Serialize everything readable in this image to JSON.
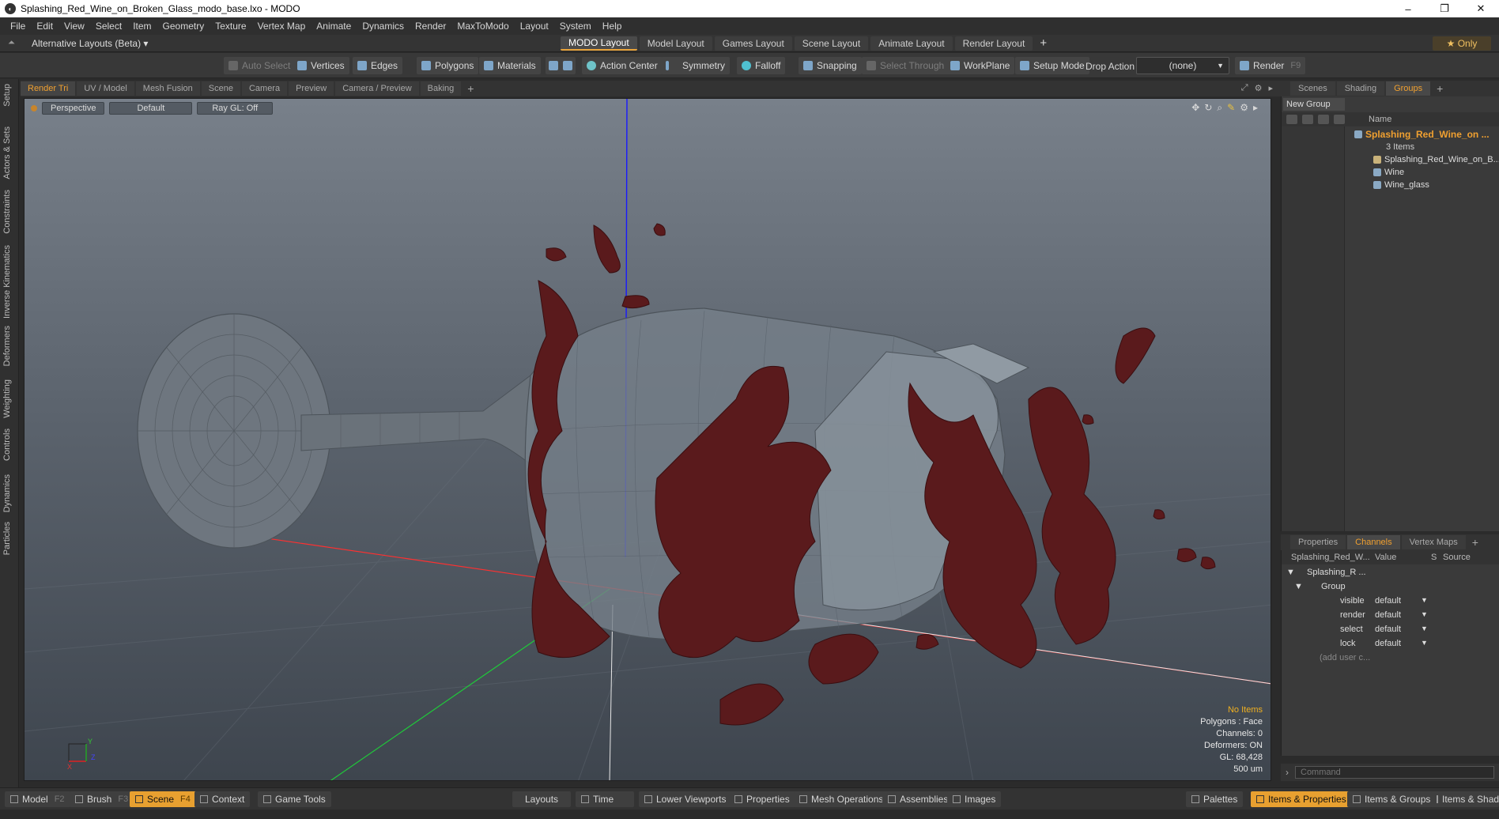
{
  "window": {
    "title": "Splashing_Red_Wine_on_Broken_Glass_modo_base.lxo - MODO",
    "minimize": "–",
    "restore": "❐",
    "close": "✕"
  },
  "menu": [
    "File",
    "Edit",
    "View",
    "Select",
    "Item",
    "Geometry",
    "Texture",
    "Vertex Map",
    "Animate",
    "Dynamics",
    "Render",
    "MaxToModo",
    "Layout",
    "System",
    "Help"
  ],
  "layoutbar": {
    "alt_layouts": "Alternative Layouts (Beta) ▾",
    "tabs": [
      "MODO Layout",
      "Model Layout",
      "Games Layout",
      "Scene Layout",
      "Animate Layout",
      "Render Layout"
    ],
    "add": "+",
    "only": "★  Only"
  },
  "toolbar": {
    "auto_select": "Auto Select",
    "vertices": "Vertices",
    "edges": "Edges",
    "polygons": "Polygons",
    "materials": "Materials",
    "action_center": "Action Center",
    "symmetry": "Symmetry",
    "falloff": "Falloff",
    "snapping": "Snapping",
    "select_through": "Select Through",
    "workplane": "WorkPlane",
    "setup_mode": "Setup Mode",
    "drop_action": "Drop Action",
    "drop_value": "(none)",
    "render": "Render",
    "render_key": "F9"
  },
  "left_tabs": [
    "Setup",
    "Actors & Sets",
    "Constraints",
    "Inverse Kinematics",
    "Deformers",
    "Weighting",
    "Controls",
    "Dynamics",
    "Particles"
  ],
  "viewport_tabs": [
    "Render Tri",
    "UV / Model",
    "Mesh Fusion",
    "Scene",
    "Camera",
    "Preview",
    "Camera / Preview",
    "Baking"
  ],
  "viewport": {
    "perspective": "Perspective",
    "default": "Default",
    "raygl": "Ray GL: Off",
    "info": {
      "no_items": "No Items",
      "polygons": "Polygons : Face",
      "channels": "Channels: 0",
      "deformers": "Deformers: ON",
      "gl": "GL: 68,428",
      "scale": "500 um"
    }
  },
  "right_tabs": [
    "Scenes",
    "Shading",
    "Groups"
  ],
  "groups": {
    "new_group": "New Group",
    "name_col": "Name",
    "group_name": "Splashing_Red_Wine_on ...",
    "count": "3 Items",
    "items": [
      "Splashing_Red_Wine_on_B...",
      "Wine",
      "Wine_glass"
    ]
  },
  "channel_tabs": [
    "Properties",
    "Channels",
    "Vertex Maps"
  ],
  "channels": {
    "head_name": "Splashing_Red_W...",
    "head_value": "Value",
    "head_s": "S",
    "head_source": "Source",
    "item": "Splashing_R ...",
    "group": "Group",
    "rows": [
      {
        "name": "visible",
        "value": "default"
      },
      {
        "name": "render",
        "value": "default"
      },
      {
        "name": "select",
        "value": "default"
      },
      {
        "name": "lock",
        "value": "default"
      }
    ],
    "add_user": "(add user c...",
    "command_placeholder": "Command"
  },
  "bottombar": {
    "model": "Model",
    "model_key": "F2",
    "brush": "Brush",
    "brush_key": "F3",
    "scene": "Scene",
    "scene_key": "F4",
    "context": "Context",
    "game_tools": "Game Tools",
    "layouts": "Layouts",
    "time": "Time",
    "lower_viewports": "Lower Viewports",
    "properties": "Properties",
    "mesh_operations": "Mesh Operations",
    "assemblies": "Assemblies",
    "images": "Images",
    "palettes": "Palettes",
    "items_properties": "Items & Properties",
    "items_groups": "Items & Groups",
    "items_shading": "Items & Shadi"
  },
  "colors": {
    "accent": "#e8a030",
    "wine": "#5a1a1c",
    "viewport_top": "#78808a",
    "viewport_bottom": "#3e454e"
  }
}
